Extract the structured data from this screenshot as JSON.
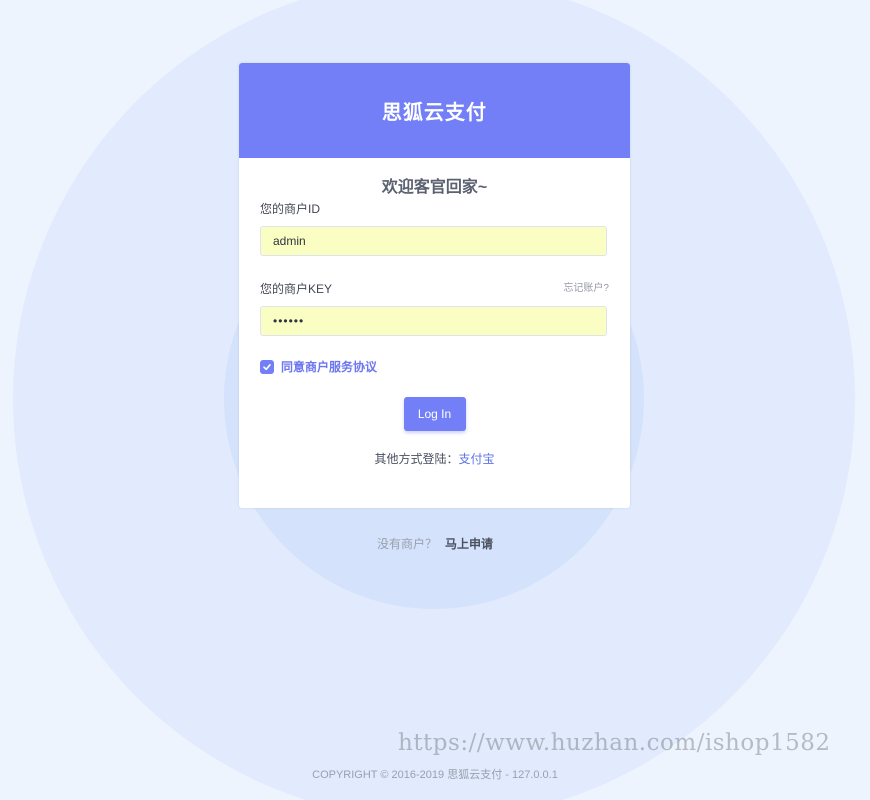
{
  "header": {
    "title": "思狐云支付"
  },
  "form": {
    "welcome": "欢迎客官回家~",
    "merchant_id_label": "您的商户ID",
    "merchant_id_value": "admin",
    "merchant_key_label": "您的商户KEY",
    "forgot_link": "忘记账户?",
    "merchant_key_value": "••••••",
    "agree_label": "同意商户服务协议",
    "agree_checked": true,
    "login_button": "Log In",
    "other_login_prefix": "其他方式登陆：",
    "other_login_link": "支付宝"
  },
  "register": {
    "prompt": "没有商户？",
    "link": "马上申请"
  },
  "footer": {
    "copyright": "COPYRIGHT © 2016-2019 思狐云支付 - 127.0.0.1"
  },
  "watermark": "https://www.huzhan.com/ishop1582",
  "colors": {
    "accent": "#737ff6",
    "input_bg": "#fafec2",
    "page_bg": "#eef4fe"
  }
}
